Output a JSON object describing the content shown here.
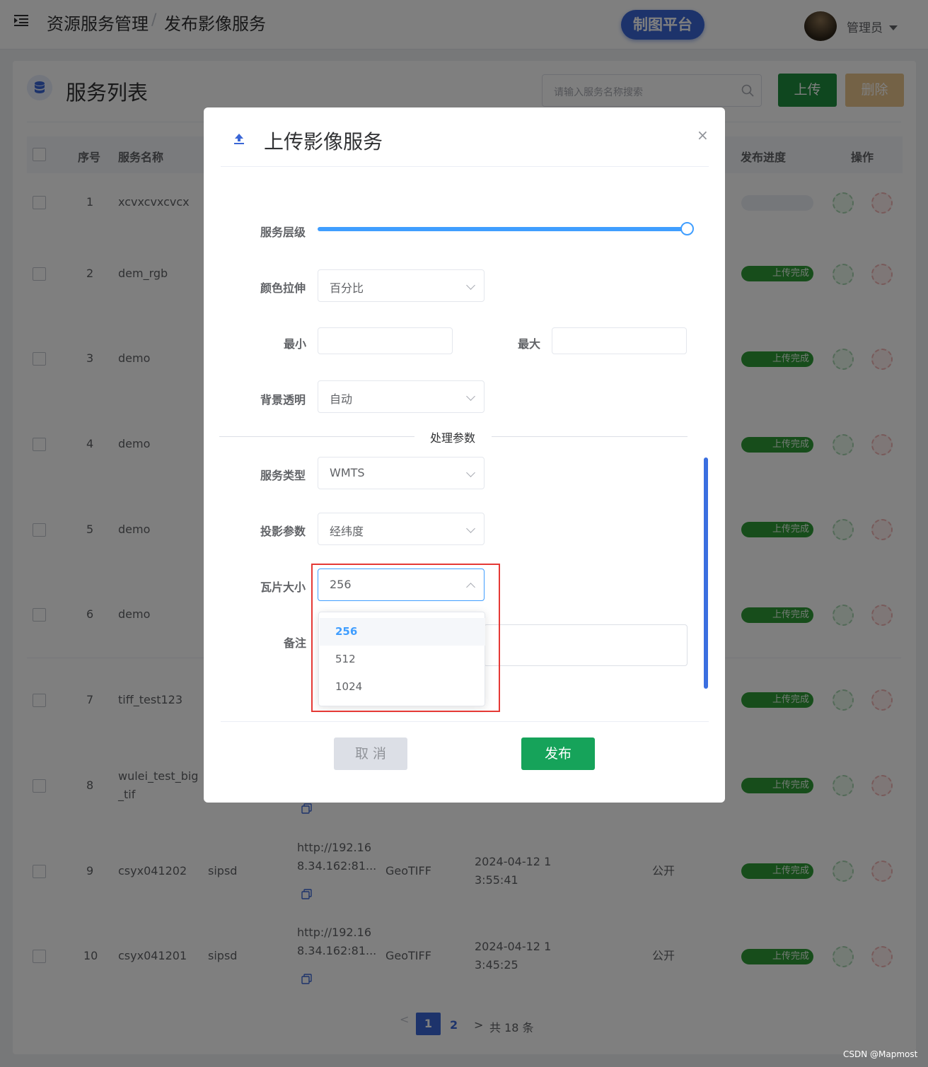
{
  "header": {
    "breadcrumb_root": "资源服务管理",
    "breadcrumb_sep": "/",
    "breadcrumb_current": "发布影像服务",
    "platform_button": "制图平台",
    "user_name": "管理员"
  },
  "list": {
    "title": "服务列表",
    "search_placeholder": "请输入服务名称搜索",
    "upload_label": "上传",
    "delete_label": "删除",
    "columns": {
      "index": "序号",
      "name": "服务名称",
      "progress": "发布进度",
      "action": "操作"
    },
    "rows": [
      {
        "index": "1",
        "name": "xcvxcvxcvcx",
        "progress": ""
      },
      {
        "index": "2",
        "name": "dem_rgb",
        "progress": "上传完成"
      },
      {
        "index": "3",
        "name": "demo",
        "progress": "上传完成"
      },
      {
        "index": "4",
        "name": "demo",
        "progress": "上传完成"
      },
      {
        "index": "5",
        "name": "demo",
        "progress": "上传完成"
      },
      {
        "index": "6",
        "name": "demo",
        "progress": "上传完成"
      },
      {
        "index": "7",
        "name": "tiff_test123",
        "progress": "上传完成"
      },
      {
        "index": "8",
        "name_l1": "wulei_test_big",
        "name_l2": "_tif",
        "progress": "上传完成"
      },
      {
        "index": "9",
        "name": "csyx041202",
        "owner": "sipsd",
        "url_l1": "http://192.16",
        "url_l2": "8.34.162:81...",
        "format": "GeoTIFF",
        "time_l1": "2024-04-12 1",
        "time_l2": "3:55:41",
        "access": "公开",
        "progress": "上传完成"
      },
      {
        "index": "10",
        "name": "csyx041201",
        "owner": "sipsd",
        "url_l1": "http://192.16",
        "url_l2": "8.34.162:81...",
        "format": "GeoTIFF",
        "time_l1": "2024-04-12 1",
        "time_l2": "3:45:25",
        "access": "公开",
        "progress": "上传完成"
      }
    ],
    "pagination": {
      "prev": "<",
      "page1": "1",
      "page2": "2",
      "next": ">",
      "total": "共 18 条"
    }
  },
  "modal": {
    "title": "上传影像服务",
    "close": "×",
    "service_level_label": "服务层级",
    "service_level_value": 1.0,
    "color_stretch_label": "颜色拉伸",
    "color_stretch_value": "百分比",
    "min_label": "最小",
    "max_label": "最大",
    "bg_transparent_label": "背景透明",
    "bg_transparent_value": "自动",
    "section_title": "处理参数",
    "service_type_label": "服务类型",
    "service_type_value": "WMTS",
    "projection_label": "投影参数",
    "projection_value": "经纬度",
    "tile_size_label": "瓦片大小",
    "tile_size_value": "256",
    "tile_size_options": [
      "256",
      "512",
      "1024"
    ],
    "remark_label": "备注",
    "cancel_label": "取 消",
    "publish_label": "发布"
  },
  "watermark": "CSDN @Mapmost",
  "colors": {
    "primary": "#409eff",
    "success": "#16a35a",
    "brand": "#3a66d6",
    "danger": "#e53935"
  }
}
